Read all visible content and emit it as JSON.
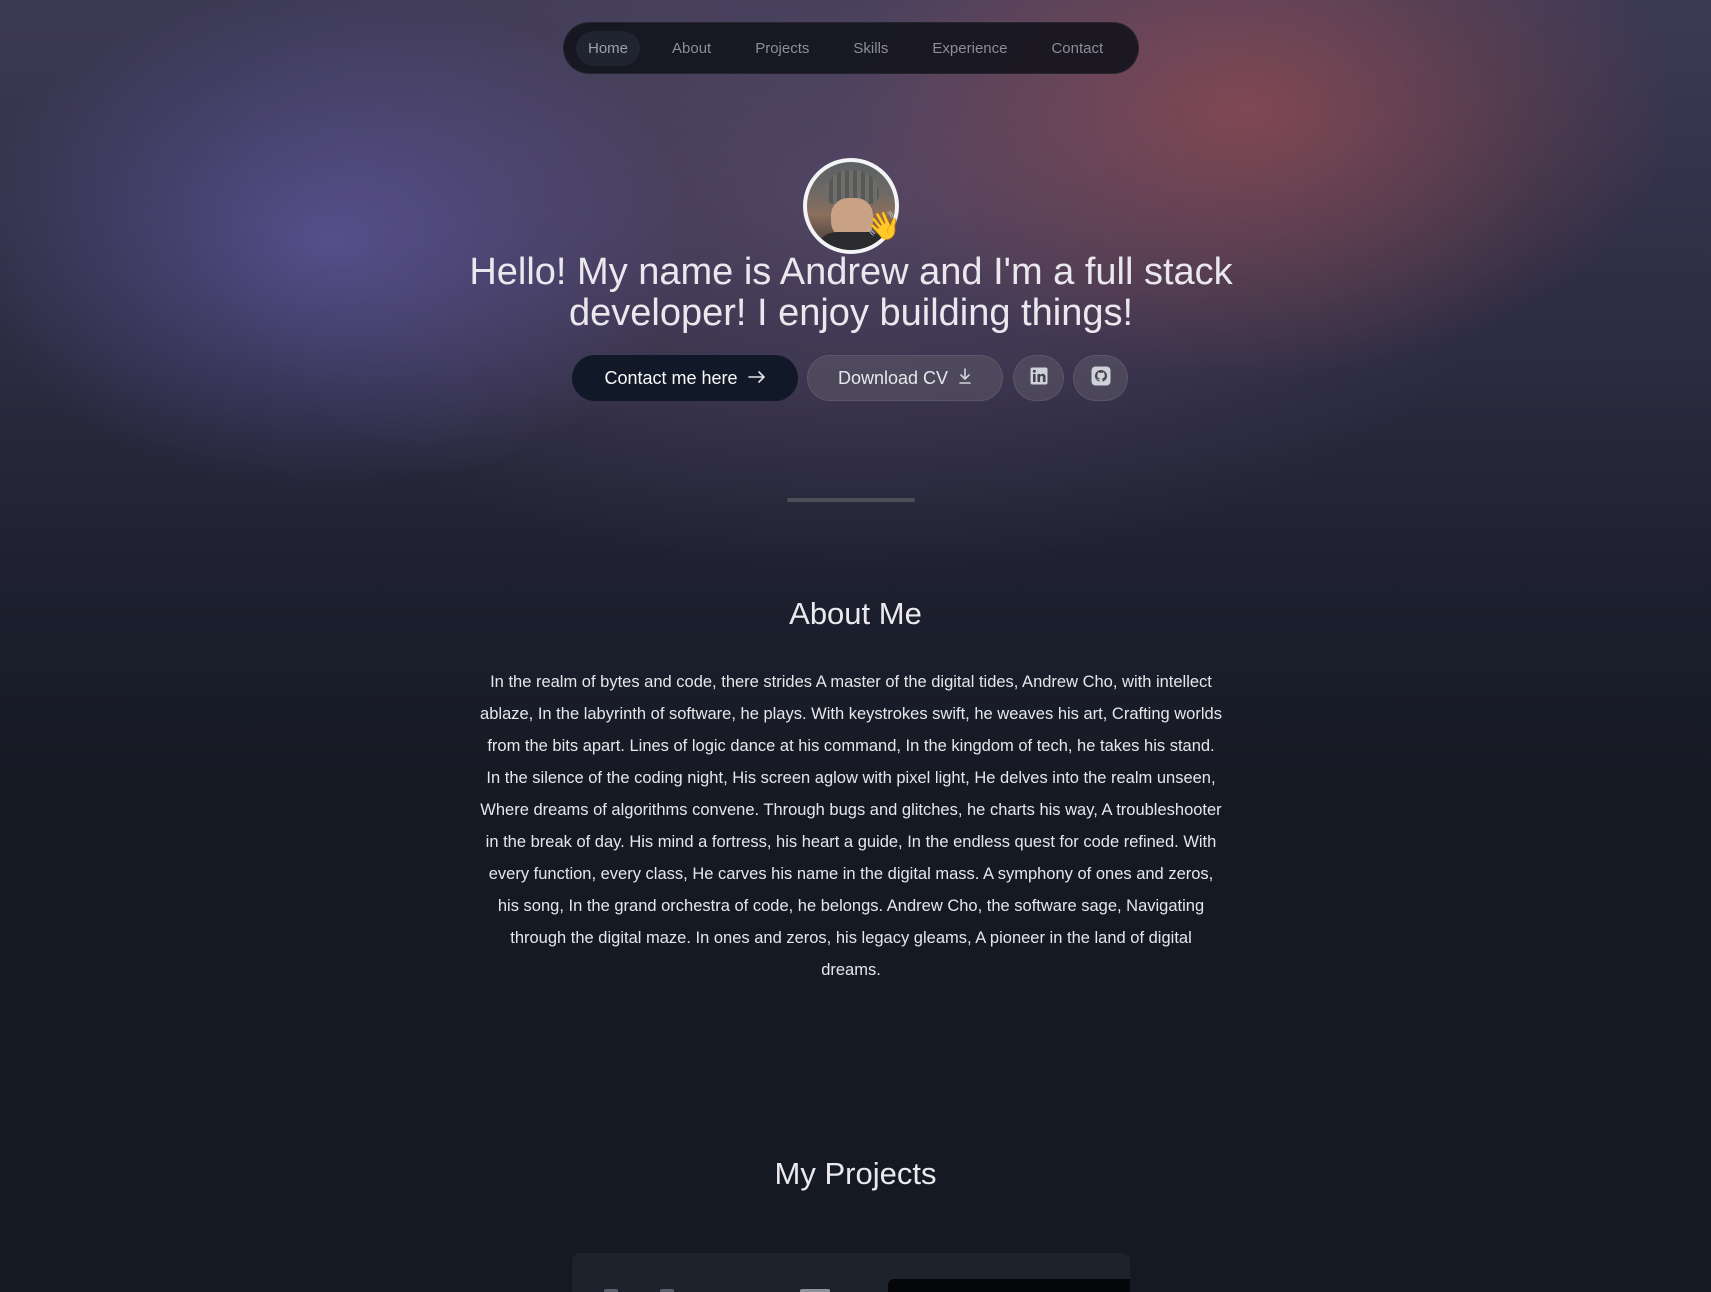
{
  "nav": {
    "items": [
      {
        "label": "Home",
        "active": true
      },
      {
        "label": "About"
      },
      {
        "label": "Projects"
      },
      {
        "label": "Skills"
      },
      {
        "label": "Experience"
      },
      {
        "label": "Contact"
      }
    ]
  },
  "hero": {
    "wave_emoji": "👋",
    "headline": "Hello! My name is Andrew and I'm a full stack developer! I enjoy building things!",
    "contact_button": "Contact me here",
    "contact_icon": "arrow-right-icon",
    "download_button": "Download CV",
    "download_icon": "download-icon",
    "linkedin_icon": "linkedin-icon",
    "github_icon": "github-icon"
  },
  "about": {
    "title": "About Me",
    "text": "In the realm of bytes and code, there strides A master of the digital tides, Andrew Cho, with intellect ablaze, In the labyrinth of software, he plays. With keystrokes swift, he weaves his art, Crafting worlds from the bits apart. Lines of logic dance at his command, In the kingdom of tech, he takes his stand. In the silence of the coding night, His screen aglow with pixel light, He delves into the realm unseen, Where dreams of algorithms convene. Through bugs and glitches, he charts his way, A troubleshooter in the break of day. His mind a fortress, his heart a guide, In the endless quest for code refined. With every function, every class, He carves his name in the digital mass. A symphony of ones and zeros, his song, In the grand orchestra of code, he belongs. Andrew Cho, the software sage, Navigating through the digital maze. In ones and zeros, his legacy gleams, A pioneer in the land of digital dreams."
  },
  "projects": {
    "title": "My Projects"
  },
  "colors": {
    "accent_dark": "#111827",
    "text": "#e5e7eb",
    "background": "#151923"
  }
}
